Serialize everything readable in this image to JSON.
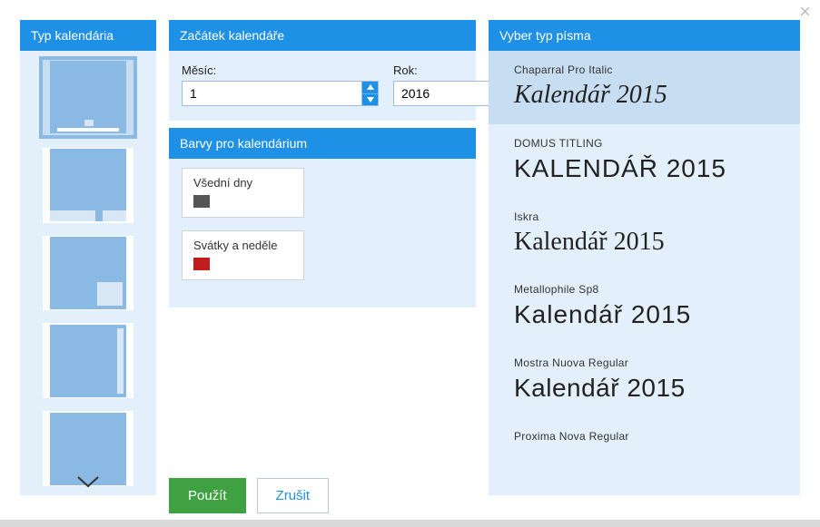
{
  "left": {
    "header": "Typ kalendária"
  },
  "start": {
    "header": "Začátek kalendáře",
    "month_label": "Měsíc:",
    "month_value": "1",
    "year_label": "Rok:",
    "year_value": "2016"
  },
  "colors": {
    "header": "Barvy pro kalendárium",
    "items": [
      {
        "label": "Všední dny",
        "color": "#555555"
      },
      {
        "label": "Svátky a neděle",
        "color": "#c21d1d"
      }
    ]
  },
  "buttons": {
    "apply": "Použít",
    "cancel": "Zrušit"
  },
  "fonts": {
    "header": "Vyber typ písma",
    "list": [
      {
        "name": "Chaparral Pro Italic",
        "sample": "Kalendář 2015",
        "selected": true,
        "style": "s-italic"
      },
      {
        "name": "DOMUS TITLING",
        "sample": "KALENDÁŘ 2015",
        "selected": false,
        "style": "s-titling"
      },
      {
        "name": "Iskra",
        "sample": "Kalendář 2015",
        "selected": false,
        "style": "s-iskra"
      },
      {
        "name": "Metallophile Sp8",
        "sample": "Kalendář 2015",
        "selected": false,
        "style": "s-metallo"
      },
      {
        "name": "Mostra Nuova Regular",
        "sample": "Kalendář 2015",
        "selected": false,
        "style": "s-mostra"
      },
      {
        "name": "Proxima Nova Regular",
        "sample": "",
        "selected": false,
        "style": ""
      }
    ]
  }
}
